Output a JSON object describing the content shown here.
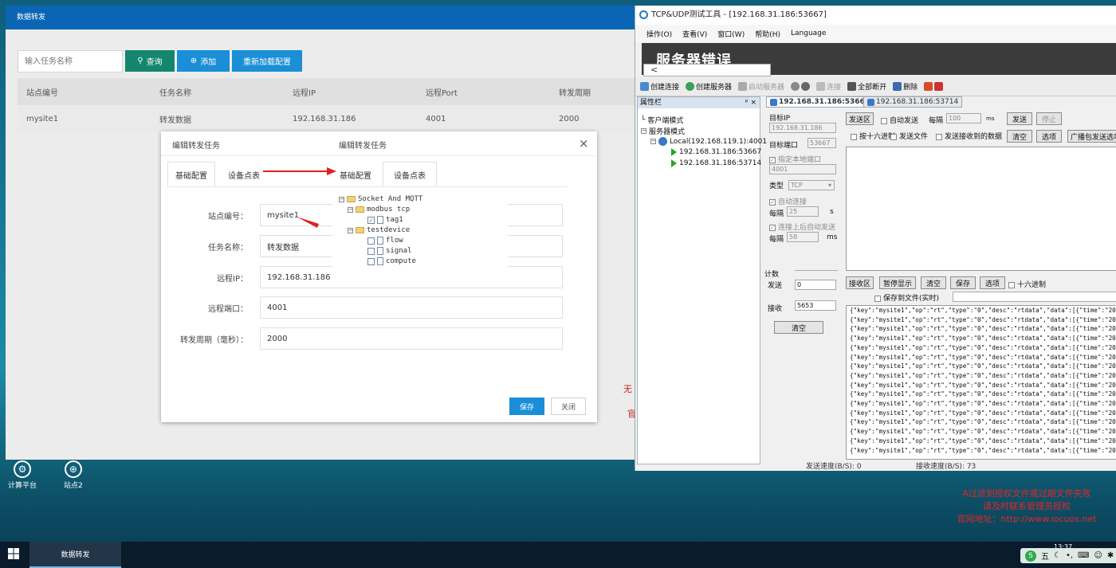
{
  "app": {
    "title": "数据转发",
    "search_placeholder": "输入任务名称",
    "btn_query": "查询",
    "btn_add": "添加",
    "btn_reload": "重新加载配置",
    "columns": [
      "站点编号",
      "任务名称",
      "远程IP",
      "远程Port",
      "转发周期"
    ],
    "rows": [
      [
        "mysite1",
        "转发数据",
        "192.168.31.186",
        "4001",
        "2000"
      ]
    ]
  },
  "modal": {
    "title": "编辑转发任务",
    "title2": "编辑转发任务",
    "close": "×",
    "tab_basic": "基础配置",
    "tab_points": "设备点表",
    "fields": [
      {
        "label": "站点编号：",
        "value": "mysite1"
      },
      {
        "label": "任务名称：",
        "value": "转发数据"
      },
      {
        "label": "远程IP：",
        "value": "192.168.31.186"
      },
      {
        "label": "远程端口：",
        "value": "4001"
      },
      {
        "label": "转发周期（毫秒）：",
        "value": "2000"
      }
    ],
    "tree": {
      "root": "Socket And MQTT",
      "g1": "modbus tcp",
      "g1_items": [
        "tag1"
      ],
      "g2": "testdevice",
      "g2_items": [
        "flow",
        "signal",
        "compute"
      ]
    },
    "btn_save": "保存",
    "btn_close": "关闭"
  },
  "desktop": {
    "icon1": "计算平台",
    "icon2": "站点2",
    "red1": "无",
    "red2": "官",
    "watermark": [
      "A过滤到授权文件或过期文件失败",
      "请及时联系管理员授权",
      "官网地址：http://www.iocuos.net"
    ]
  },
  "tcp": {
    "title": "TCP&UDP测试工具 - [192.168.31.186:53667]",
    "menu": [
      "操作(O)",
      "查看(V)",
      "窗口(W)",
      "帮助(H)",
      "Language"
    ],
    "error_banner": "服务器错误",
    "back": "<",
    "toolbar": {
      "create_conn": "创建连接",
      "create_server": "创建服务器",
      "auto_server": "启动服务器",
      "connect": "连接",
      "disconnect_all": "全部断开",
      "delete": "删除"
    },
    "prop_title": "属性栏",
    "pin": "ᵖ ×",
    "tree": {
      "client": "客户端模式",
      "server": "服务器模式",
      "local": "Local(192.168.119.1):4001",
      "conn1": "192.168.31.186:53667",
      "conn2": "192.168.31.186:53714"
    },
    "tab1": "192.168.31.186:53667",
    "tab2": "192.168.31.186:53714",
    "target_ip_label": "目标IP",
    "target_ip": "192.168.31.186",
    "target_port_label": "目标端口",
    "target_port": "53667",
    "local_port_label": "指定本地端口",
    "local_port": "4001",
    "type_label": "类型",
    "type": "TCP",
    "auto_conn_label": "自动连接",
    "interval_label": "每隔",
    "interval1": "25",
    "unit_s": "s",
    "auto_send_label": "连接上后自动发送",
    "interval2": "58",
    "unit_ms": "ms",
    "count_label": "计数",
    "send_label": "发送",
    "send_count": "0",
    "recv_label": "接收",
    "recv_count": "5653",
    "clear_count": "清空",
    "send_area_btn": "发送区",
    "auto_send": "自动发送",
    "every": "每隔",
    "every_value": "100",
    "every_unit": "ms",
    "btn_send": "发送",
    "btn_stop": "停止",
    "hex_send": "按十六进制",
    "send_file": "发送文件",
    "send_recv_data": "发送接收到的数据",
    "btn_clear_send": "清空",
    "btn_option_send": "选项",
    "broadcast": "广播包发送选项",
    "recv_area_btn": "接收区",
    "pause_display": "暂停显示",
    "btn_clear_recv": "清空",
    "btn_save_recv": "保存",
    "btn_option_recv": "选项",
    "hex16": "十六进制",
    "save_to_file": "保存到文件(实时)",
    "recv_lines": [
      "{\"key\":\"mysite1\",\"op\":\"rt\",\"type\":\"0\",\"desc\":\"rtdata\",\"data\":[{\"time\":\"2020-0",
      "{\"key\":\"mysite1\",\"op\":\"rt\",\"type\":\"0\",\"desc\":\"rtdata\",\"data\":[{\"time\":\"2020-0",
      "{\"key\":\"mysite1\",\"op\":\"rt\",\"type\":\"0\",\"desc\":\"rtdata\",\"data\":[{\"time\":\"2020-0",
      "{\"key\":\"mysite1\",\"op\":\"rt\",\"type\":\"0\",\"desc\":\"rtdata\",\"data\":[{\"time\":\"2020-0",
      "{\"key\":\"mysite1\",\"op\":\"rt\",\"type\":\"0\",\"desc\":\"rtdata\",\"data\":[{\"time\":\"2020-0",
      "{\"key\":\"mysite1\",\"op\":\"rt\",\"type\":\"0\",\"desc\":\"rtdata\",\"data\":[{\"time\":\"2020-0",
      "{\"key\":\"mysite1\",\"op\":\"rt\",\"type\":\"0\",\"desc\":\"rtdata\",\"data\":[{\"time\":\"2020-0",
      "{\"key\":\"mysite1\",\"op\":\"rt\",\"type\":\"0\",\"desc\":\"rtdata\",\"data\":[{\"time\":\"2020-0",
      "{\"key\":\"mysite1\",\"op\":\"rt\",\"type\":\"0\",\"desc\":\"rtdata\",\"data\":[{\"time\":\"2020-0",
      "{\"key\":\"mysite1\",\"op\":\"rt\",\"type\":\"0\",\"desc\":\"rtdata\",\"data\":[{\"time\":\"2020-0",
      "{\"key\":\"mysite1\",\"op\":\"rt\",\"type\":\"0\",\"desc\":\"rtdata\",\"data\":[{\"time\":\"2020-0",
      "{\"key\":\"mysite1\",\"op\":\"rt\",\"type\":\"0\",\"desc\":\"rtdata\",\"data\":[{\"time\":\"2020-0",
      "{\"key\":\"mysite1\",\"op\":\"rt\",\"type\":\"0\",\"desc\":\"rtdata\",\"data\":[{\"time\":\"2020-0",
      "{\"key\":\"mysite1\",\"op\":\"rt\",\"type\":\"0\",\"desc\":\"rtdata\",\"data\":[{\"time\":\"2020-0",
      "{\"key\":\"mysite1\",\"op\":\"rt\",\"type\":\"0\",\"desc\":\"rtdata\",\"data\":[{\"time\":\"2020-0",
      "{\"key\":\"mysite1\",\"op\":\"rt\",\"type\":\"0\",\"desc\":\"rtdata\",\"data\":[{\"time\":\"2020-0"
    ],
    "status_send": "发送速度(B/S): 0",
    "status_recv": "接收速度(B/S): 73"
  },
  "taskbar": {
    "task": "数据转发",
    "clock": "13:37",
    "ime": "五"
  }
}
